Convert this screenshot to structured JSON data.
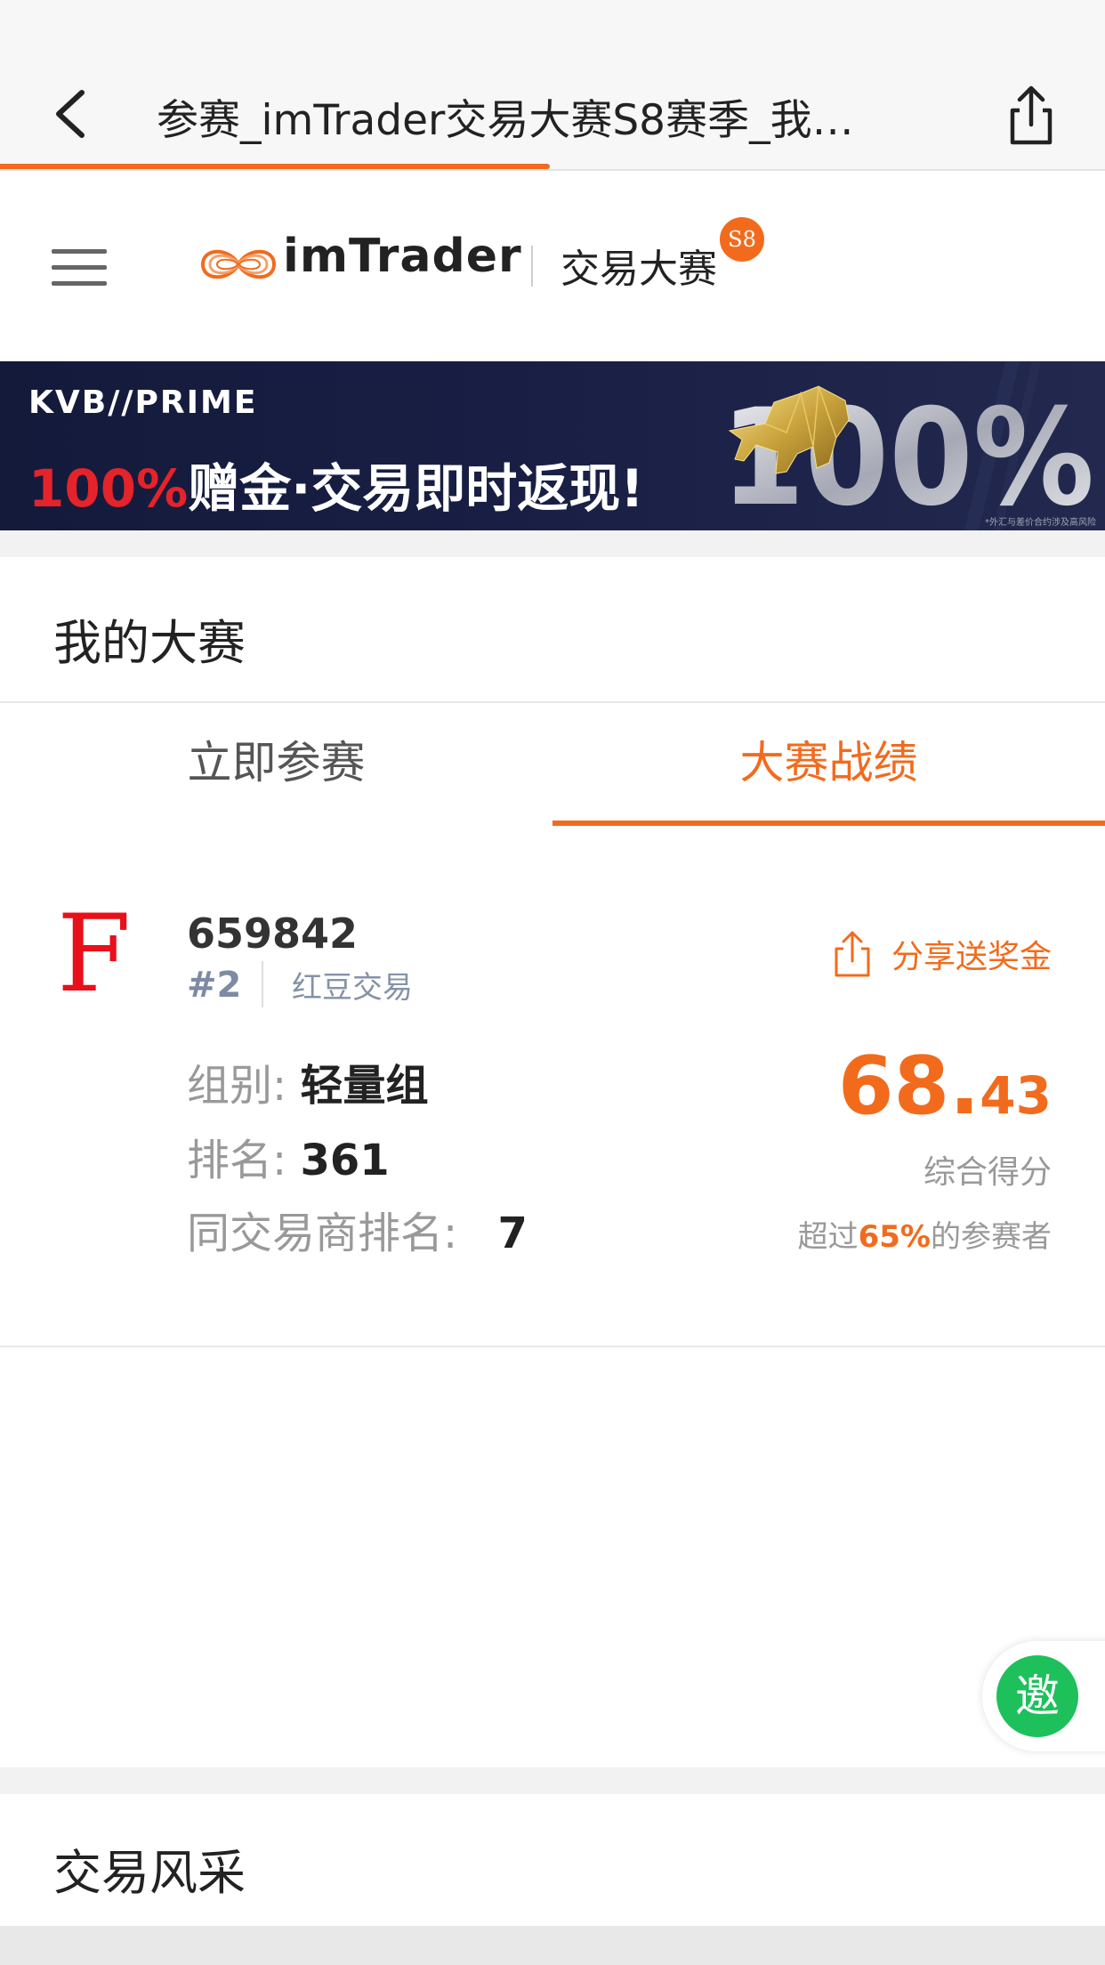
{
  "browser": {
    "title": "参赛_imTrader交易大赛S8赛季_我…"
  },
  "header": {
    "brand": "imTrader",
    "contest_name": "交易大赛",
    "season_badge": "S8"
  },
  "banner": {
    "brand": "KVB//PRIME",
    "headline_highlight": "100%",
    "headline_rest": "赠金·交易即时返现!",
    "graphic_text": "100%",
    "disclaimer": "*外汇与差价合约涉及高风险"
  },
  "my_contest": {
    "title": "我的大赛",
    "tabs": [
      {
        "label": "立即参赛",
        "active": false
      },
      {
        "label": "大赛战绩",
        "active": true
      }
    ]
  },
  "record": {
    "avatar_letter": "F",
    "account_id": "659842",
    "rank_tag": "#2",
    "broker": "红豆交易",
    "share_label": "分享送奖金",
    "group_label": "组别:",
    "group_value": "轻量组",
    "rank_label": "排名:",
    "rank_value": "361",
    "broker_rank_label": "同交易商排名:",
    "broker_rank_value": "7",
    "score_int": "68.",
    "score_dec": "43",
    "score_label": "综合得分",
    "beat_prefix": "超过",
    "beat_percent": "65%",
    "beat_suffix": "的参赛者"
  },
  "invite": {
    "label": "邀"
  },
  "trade_style": {
    "title": "交易风采"
  },
  "colors": {
    "accent": "#f26b1d",
    "invite_green": "#1ec05c",
    "avatar_red": "#e8101a",
    "banner_bg": "#141a3a"
  }
}
